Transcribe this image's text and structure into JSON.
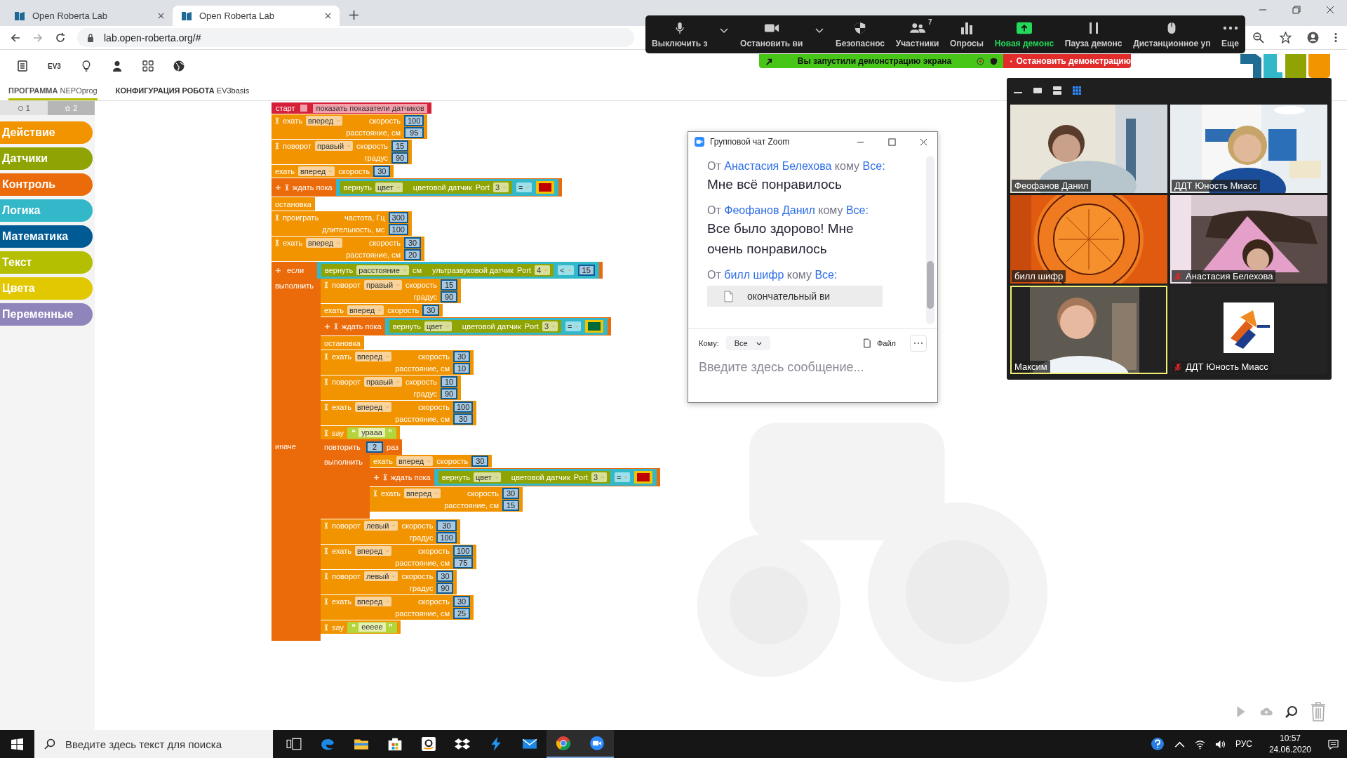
{
  "browser": {
    "tabs": [
      {
        "title": "Open Roberta Lab",
        "selected": false
      },
      {
        "title": "Open Roberta Lab",
        "selected": true
      }
    ],
    "url": "lab.open-roberta.org/#"
  },
  "roberta": {
    "robot_label": "EV3",
    "tabs": [
      {
        "title": "ПРОГРАММА",
        "name": "NEPOprog",
        "selected": true
      },
      {
        "title": "КОНФИГУРАЦИЯ РОБОТА",
        "name": "EV3basis",
        "selected": false
      }
    ],
    "toolbox": {
      "tabs": [
        {
          "label": "1",
          "selected": true
        },
        {
          "label": "2",
          "selected": false
        }
      ],
      "categories": [
        {
          "label": "Действие",
          "color": "#f29400"
        },
        {
          "label": "Датчики",
          "color": "#8fa402"
        },
        {
          "label": "Контроль",
          "color": "#eb6a0a"
        },
        {
          "label": "Логика",
          "color": "#33b8ca"
        },
        {
          "label": "Математика",
          "color": "#005a94"
        },
        {
          "label": "Текст",
          "color": "#b3bf00"
        },
        {
          "label": "Цвета",
          "color": "#e2c800"
        },
        {
          "label": "Переменные",
          "color": "#9085ba"
        }
      ]
    }
  },
  "program": [
    {
      "kind": "start",
      "label": "старт",
      "checked": false,
      "option": "показать показатели датчиков"
    },
    {
      "kind": "action",
      "hourglass": true,
      "lines": [
        {
          "verb": "ехать",
          "option": "вперед",
          "param": "скорость",
          "value": "100"
        },
        {
          "param": "расстояние, см",
          "value": "95"
        }
      ]
    },
    {
      "kind": "action",
      "hourglass": true,
      "lines": [
        {
          "verb": "поворот",
          "option": "правый",
          "param": "скорость",
          "value": "15"
        },
        {
          "param": "градус",
          "value": "90"
        }
      ]
    },
    {
      "kind": "action",
      "hourglass": false,
      "lines": [
        {
          "verb": "ехать",
          "option": "вперед",
          "param": "скорость",
          "value": "30"
        }
      ]
    },
    {
      "kind": "wait",
      "hourglass": true,
      "label": "ждать пока",
      "condition": {
        "verb": "вернуть",
        "mode": "цвет",
        "sensor": "цветовой датчик",
        "port_label": "Port",
        "port": "3",
        "op": "=",
        "right": {
          "kind": "color",
          "color": "#c00000"
        }
      }
    },
    {
      "kind": "stop",
      "label": "остановка"
    },
    {
      "kind": "action",
      "hourglass": true,
      "lines": [
        {
          "verb": "проиграть",
          "param": "частота, Гц",
          "value": "300"
        },
        {
          "param": "длительность, мс",
          "value": "100"
        }
      ]
    },
    {
      "kind": "action",
      "hourglass": true,
      "lines": [
        {
          "verb": "ехать",
          "option": "вперед",
          "param": "скорость",
          "value": "30"
        },
        {
          "param": "расстояние, см",
          "value": "20"
        }
      ]
    },
    {
      "kind": "if",
      "label": "если",
      "condition": {
        "verb": "вернуть",
        "mode": "расстояние",
        "unit": "см",
        "sensor": "ультразвуковой датчик",
        "port_label": "Port",
        "port": "4",
        "op": "<",
        "right": {
          "kind": "number",
          "value": "15"
        }
      },
      "then_label": "выполнить",
      "then": [
        {
          "kind": "action",
          "hourglass": true,
          "lines": [
            {
              "verb": "поворот",
              "option": "правый",
              "param": "скорость",
              "value": "15"
            },
            {
              "param": "градус",
              "value": "90"
            }
          ]
        },
        {
          "kind": "action",
          "hourglass": false,
          "lines": [
            {
              "verb": "ехать",
              "option": "вперед",
              "param": "скорость",
              "value": "30"
            }
          ]
        },
        {
          "kind": "wait",
          "hourglass": true,
          "label": "ждать пока",
          "condition": {
            "verb": "вернуть",
            "mode": "цвет",
            "sensor": "цветовой датчик",
            "port_label": "Port",
            "port": "3",
            "op": "=",
            "right": {
              "kind": "color",
              "color": "#006b3a"
            }
          }
        },
        {
          "kind": "stop",
          "label": "остановка"
        },
        {
          "kind": "action",
          "hourglass": true,
          "lines": [
            {
              "verb": "ехать",
              "option": "вперед",
              "param": "скорость",
              "value": "30"
            },
            {
              "param": "расстояние, см",
              "value": "10"
            }
          ]
        },
        {
          "kind": "action",
          "hourglass": true,
          "lines": [
            {
              "verb": "поворот",
              "option": "правый",
              "param": "скорость",
              "value": "10"
            },
            {
              "param": "градус",
              "value": "90"
            }
          ]
        },
        {
          "kind": "action",
          "hourglass": true,
          "lines": [
            {
              "verb": "ехать",
              "option": "вперед",
              "param": "скорость",
              "value": "100"
            },
            {
              "param": "расстояние, см",
              "value": "30"
            }
          ]
        },
        {
          "kind": "say",
          "hourglass": true,
          "label": "say",
          "open_quote": "“",
          "text": "урааа",
          "close_quote": "”"
        }
      ],
      "else_label": "иначе",
      "else": [
        {
          "kind": "repeat",
          "label": "повторить",
          "count": "2",
          "unit": "раз",
          "do_label": "выполнить",
          "do": [
            {
              "kind": "action",
              "hourglass": false,
              "lines": [
                {
                  "verb": "ехать",
                  "option": "вперед",
                  "param": "скорость",
                  "value": "30"
                }
              ]
            },
            {
              "kind": "wait",
              "hourglass": true,
              "label": "ждать пока",
              "condition": {
                "verb": "вернуть",
                "mode": "цвет",
                "sensor": "цветовой датчик",
                "port_label": "Port",
                "port": "3",
                "op": "=",
                "right": {
                  "kind": "color",
                  "color": "#c00000"
                }
              }
            },
            {
              "kind": "action",
              "hourglass": true,
              "lines": [
                {
                  "verb": "ехать",
                  "option": "вперед",
                  "param": "скорость",
                  "value": "30"
                },
                {
                  "param": "расстояние, см",
                  "value": "15"
                }
              ]
            }
          ]
        },
        {
          "kind": "action",
          "hourglass": true,
          "lines": [
            {
              "verb": "поворот",
              "option": "левый",
              "param": "скорость",
              "value": "30"
            },
            {
              "param": "градус",
              "value": "100"
            }
          ]
        },
        {
          "kind": "action",
          "hourglass": true,
          "lines": [
            {
              "verb": "ехать",
              "option": "вперед",
              "param": "скорость",
              "value": "100"
            },
            {
              "param": "расстояние, см",
              "value": "75"
            }
          ]
        },
        {
          "kind": "action",
          "hourglass": true,
          "lines": [
            {
              "verb": "поворот",
              "option": "левый",
              "param": "скорость",
              "value": "30"
            },
            {
              "param": "градус",
              "value": "90"
            }
          ]
        },
        {
          "kind": "action",
          "hourglass": true,
          "lines": [
            {
              "verb": "ехать",
              "option": "вперед",
              "param": "скорость",
              "value": "30"
            },
            {
              "param": "расстояние, см",
              "value": "25"
            }
          ]
        },
        {
          "kind": "say",
          "hourglass": true,
          "label": "say",
          "open_quote": "“",
          "text": "eeeee",
          "close_quote": "”"
        }
      ]
    }
  ],
  "zoom_toolbar": [
    {
      "label": "Выключить з",
      "chevron": true,
      "active": false
    },
    {
      "label": "Остановить ви",
      "chevron": true,
      "active": false
    },
    {
      "label": "Безопаснос",
      "chevron": false,
      "active": false
    },
    {
      "label": "Участники",
      "badge": "7",
      "chevron": false,
      "active": false
    },
    {
      "label": "Опросы",
      "chevron": false,
      "active": false
    },
    {
      "label": "Новая демонс",
      "chevron": false,
      "active": true
    },
    {
      "label": "Пауза демонс",
      "chevron": false,
      "active": false
    },
    {
      "label": "Дистанционное уп",
      "chevron": false,
      "active": false
    },
    {
      "label": "Еще",
      "chevron": false,
      "active": false
    }
  ],
  "share_bar": {
    "status": "Вы запустили демонстрацию экрана",
    "stop": "Остановить демонстрацию"
  },
  "chat": {
    "title": "Групповой чат Zoom",
    "messages": [
      {
        "from_word": "От",
        "sender": "Анастасия Белехова",
        "to_word": "кому",
        "recipient": "Все:",
        "text": "Мне всё понравилось"
      },
      {
        "from_word": "От",
        "sender": "Феофанов Данил",
        "to_word": "кому",
        "recipient": "Все:",
        "text": "Все было здорово! Мне очень понравилось"
      },
      {
        "from_word": "От",
        "sender": "билл шифр",
        "to_word": "кому",
        "recipient": "Все:",
        "file": "окончательный ви"
      }
    ],
    "to_label": "Кому:",
    "to_value": "Все",
    "file_button": "Файл",
    "placeholder": "Введите здесь сообщение..."
  },
  "video": {
    "views": [
      {
        "selected": false
      },
      {
        "selected": false
      },
      {
        "selected": false
      },
      {
        "selected": true
      }
    ],
    "tiles": [
      {
        "name": "Феофанов Данил",
        "muted": false,
        "speaking": false
      },
      {
        "name": "ДДТ Юность Миасс",
        "muted": false,
        "speaking": false
      },
      {
        "name": "билл шифр",
        "muted": false,
        "speaking": false
      },
      {
        "name": "Анастасия Белехова",
        "muted": true,
        "speaking": false
      },
      {
        "name": "Максим",
        "muted": false,
        "speaking": true
      },
      {
        "name": "ДДТ Юность Миасс",
        "muted": true,
        "speaking": false
      }
    ]
  },
  "taskbar": {
    "search_placeholder": "Введите здесь текст для поиска",
    "apps": [
      {
        "active": false
      },
      {
        "active": false
      },
      {
        "active": false
      },
      {
        "active": false
      },
      {
        "active": false
      },
      {
        "active": false
      },
      {
        "active": false
      },
      {
        "active": false
      },
      {
        "active": true
      },
      {
        "active": true
      }
    ],
    "language": "РУС",
    "time": "10:57",
    "date": "24.06.2020"
  }
}
